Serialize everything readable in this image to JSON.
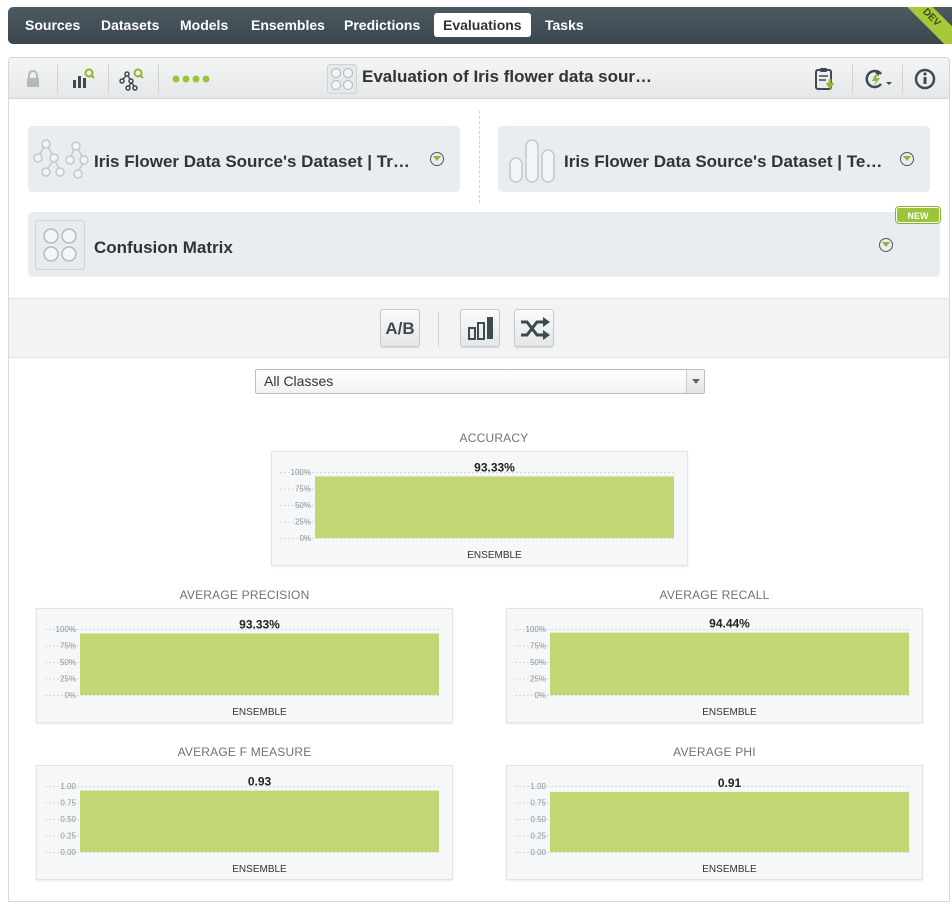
{
  "nav": {
    "tabs": [
      {
        "label": "Sources",
        "active": false
      },
      {
        "label": "Datasets",
        "active": false
      },
      {
        "label": "Models",
        "active": false
      },
      {
        "label": "Ensembles",
        "active": false
      },
      {
        "label": "Predictions",
        "active": false
      },
      {
        "label": "Evaluations",
        "active": true
      },
      {
        "label": "Tasks",
        "active": false
      }
    ],
    "ribbon": "DEV"
  },
  "toolbar": {
    "title": "Evaluation of Iris flower data sour…",
    "icons": [
      "lock-icon",
      "bar-chart-search-icon",
      "tree-search-icon",
      "dots-icon",
      "clipboard-download-icon",
      "reload-menu-icon",
      "info-icon"
    ]
  },
  "cards": {
    "train": {
      "label": "Iris Flower Data Source's Dataset | Tr…",
      "icon": "tree-icon"
    },
    "test": {
      "label": "Iris Flower Data Source's Dataset | Te…",
      "icon": "histogram-icon"
    },
    "confusion": {
      "label": "Confusion Matrix",
      "icon": "matrix-icon",
      "badge": "NEW"
    }
  },
  "buttons": {
    "ab": "A/B"
  },
  "class_select": {
    "value": "All Classes"
  },
  "colors": {
    "bar": "#c2d774",
    "accent": "#9cc43a",
    "nav_bg": "#3f4c53"
  },
  "chart_data": [
    {
      "type": "bar",
      "title": "ACCURACY",
      "categories": [
        "ENSEMBLE"
      ],
      "values": [
        93.33
      ],
      "value_label": "93.33%",
      "yticks": [
        "100%",
        "75%",
        "50%",
        "25%",
        "0%"
      ],
      "ylim": [
        0,
        100
      ]
    },
    {
      "type": "bar",
      "title": "AVERAGE PRECISION",
      "categories": [
        "ENSEMBLE"
      ],
      "values": [
        93.33
      ],
      "value_label": "93.33%",
      "yticks": [
        "100%",
        "75%",
        "50%",
        "25%",
        "0%"
      ],
      "ylim": [
        0,
        100
      ]
    },
    {
      "type": "bar",
      "title": "AVERAGE RECALL",
      "categories": [
        "ENSEMBLE"
      ],
      "values": [
        94.44
      ],
      "value_label": "94.44%",
      "yticks": [
        "100%",
        "75%",
        "50%",
        "25%",
        "0%"
      ],
      "ylim": [
        0,
        100
      ]
    },
    {
      "type": "bar",
      "title": "AVERAGE F MEASURE",
      "categories": [
        "ENSEMBLE"
      ],
      "values": [
        0.93
      ],
      "value_label": "0.93",
      "yticks": [
        "1.00",
        "0.75",
        "0.50",
        "0.25",
        "0.00"
      ],
      "ylim": [
        0,
        1
      ]
    },
    {
      "type": "bar",
      "title": "AVERAGE PHI",
      "categories": [
        "ENSEMBLE"
      ],
      "values": [
        0.91
      ],
      "value_label": "0.91",
      "yticks": [
        "1.00",
        "0.75",
        "0.50",
        "0.25",
        "0.00"
      ],
      "ylim": [
        0,
        1
      ]
    }
  ]
}
